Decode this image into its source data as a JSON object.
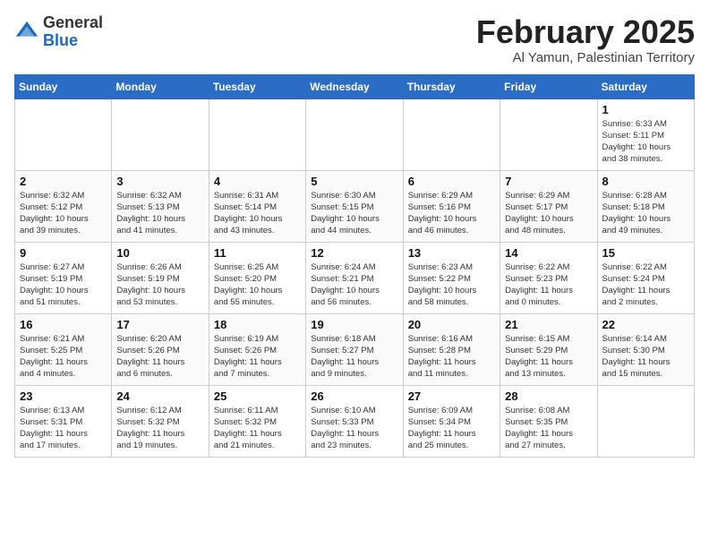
{
  "header": {
    "logo_general": "General",
    "logo_blue": "Blue",
    "title": "February 2025",
    "subtitle": "Al Yamun, Palestinian Territory"
  },
  "days_of_week": [
    "Sunday",
    "Monday",
    "Tuesday",
    "Wednesday",
    "Thursday",
    "Friday",
    "Saturday"
  ],
  "weeks": [
    [
      {
        "day": "",
        "info": ""
      },
      {
        "day": "",
        "info": ""
      },
      {
        "day": "",
        "info": ""
      },
      {
        "day": "",
        "info": ""
      },
      {
        "day": "",
        "info": ""
      },
      {
        "day": "",
        "info": ""
      },
      {
        "day": "1",
        "info": "Sunrise: 6:33 AM\nSunset: 5:11 PM\nDaylight: 10 hours\nand 38 minutes."
      }
    ],
    [
      {
        "day": "2",
        "info": "Sunrise: 6:32 AM\nSunset: 5:12 PM\nDaylight: 10 hours\nand 39 minutes."
      },
      {
        "day": "3",
        "info": "Sunrise: 6:32 AM\nSunset: 5:13 PM\nDaylight: 10 hours\nand 41 minutes."
      },
      {
        "day": "4",
        "info": "Sunrise: 6:31 AM\nSunset: 5:14 PM\nDaylight: 10 hours\nand 43 minutes."
      },
      {
        "day": "5",
        "info": "Sunrise: 6:30 AM\nSunset: 5:15 PM\nDaylight: 10 hours\nand 44 minutes."
      },
      {
        "day": "6",
        "info": "Sunrise: 6:29 AM\nSunset: 5:16 PM\nDaylight: 10 hours\nand 46 minutes."
      },
      {
        "day": "7",
        "info": "Sunrise: 6:29 AM\nSunset: 5:17 PM\nDaylight: 10 hours\nand 48 minutes."
      },
      {
        "day": "8",
        "info": "Sunrise: 6:28 AM\nSunset: 5:18 PM\nDaylight: 10 hours\nand 49 minutes."
      }
    ],
    [
      {
        "day": "9",
        "info": "Sunrise: 6:27 AM\nSunset: 5:19 PM\nDaylight: 10 hours\nand 51 minutes."
      },
      {
        "day": "10",
        "info": "Sunrise: 6:26 AM\nSunset: 5:19 PM\nDaylight: 10 hours\nand 53 minutes."
      },
      {
        "day": "11",
        "info": "Sunrise: 6:25 AM\nSunset: 5:20 PM\nDaylight: 10 hours\nand 55 minutes."
      },
      {
        "day": "12",
        "info": "Sunrise: 6:24 AM\nSunset: 5:21 PM\nDaylight: 10 hours\nand 56 minutes."
      },
      {
        "day": "13",
        "info": "Sunrise: 6:23 AM\nSunset: 5:22 PM\nDaylight: 10 hours\nand 58 minutes."
      },
      {
        "day": "14",
        "info": "Sunrise: 6:22 AM\nSunset: 5:23 PM\nDaylight: 11 hours\nand 0 minutes."
      },
      {
        "day": "15",
        "info": "Sunrise: 6:22 AM\nSunset: 5:24 PM\nDaylight: 11 hours\nand 2 minutes."
      }
    ],
    [
      {
        "day": "16",
        "info": "Sunrise: 6:21 AM\nSunset: 5:25 PM\nDaylight: 11 hours\nand 4 minutes."
      },
      {
        "day": "17",
        "info": "Sunrise: 6:20 AM\nSunset: 5:26 PM\nDaylight: 11 hours\nand 6 minutes."
      },
      {
        "day": "18",
        "info": "Sunrise: 6:19 AM\nSunset: 5:26 PM\nDaylight: 11 hours\nand 7 minutes."
      },
      {
        "day": "19",
        "info": "Sunrise: 6:18 AM\nSunset: 5:27 PM\nDaylight: 11 hours\nand 9 minutes."
      },
      {
        "day": "20",
        "info": "Sunrise: 6:16 AM\nSunset: 5:28 PM\nDaylight: 11 hours\nand 11 minutes."
      },
      {
        "day": "21",
        "info": "Sunrise: 6:15 AM\nSunset: 5:29 PM\nDaylight: 11 hours\nand 13 minutes."
      },
      {
        "day": "22",
        "info": "Sunrise: 6:14 AM\nSunset: 5:30 PM\nDaylight: 11 hours\nand 15 minutes."
      }
    ],
    [
      {
        "day": "23",
        "info": "Sunrise: 6:13 AM\nSunset: 5:31 PM\nDaylight: 11 hours\nand 17 minutes."
      },
      {
        "day": "24",
        "info": "Sunrise: 6:12 AM\nSunset: 5:32 PM\nDaylight: 11 hours\nand 19 minutes."
      },
      {
        "day": "25",
        "info": "Sunrise: 6:11 AM\nSunset: 5:32 PM\nDaylight: 11 hours\nand 21 minutes."
      },
      {
        "day": "26",
        "info": "Sunrise: 6:10 AM\nSunset: 5:33 PM\nDaylight: 11 hours\nand 23 minutes."
      },
      {
        "day": "27",
        "info": "Sunrise: 6:09 AM\nSunset: 5:34 PM\nDaylight: 11 hours\nand 25 minutes."
      },
      {
        "day": "28",
        "info": "Sunrise: 6:08 AM\nSunset: 5:35 PM\nDaylight: 11 hours\nand 27 minutes."
      },
      {
        "day": "",
        "info": ""
      }
    ]
  ]
}
